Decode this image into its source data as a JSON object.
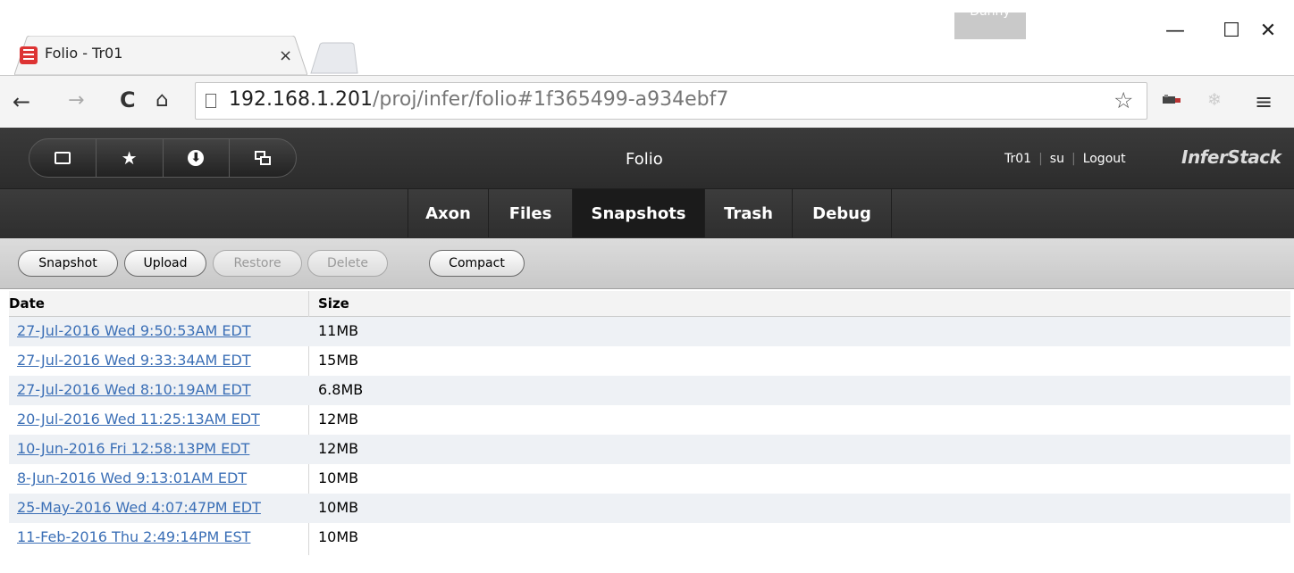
{
  "browser": {
    "profile": "Danny",
    "tab_title": "Folio - Tr01",
    "tab_close": "×",
    "url_host": "192.168.1.201",
    "url_path": "/proj/infer/folio#1f365499-a934ebf7",
    "window_min": "—",
    "window_max": "☐",
    "window_close": "✕",
    "back": "←",
    "forward": "→",
    "reload": "C",
    "home": "⌂",
    "bookmark_star": "☆",
    "menu": "≡"
  },
  "app": {
    "title": "Folio",
    "user": "Tr01",
    "role": "su",
    "logout": "Logout",
    "brand": "InferStack",
    "icons": [
      "window-icon",
      "star-icon",
      "download-icon",
      "windows-icon"
    ],
    "star_glyph": "★",
    "download_glyph": "⬇"
  },
  "nav": {
    "tabs": [
      {
        "label": "Axon",
        "active": false
      },
      {
        "label": "Files",
        "active": false
      },
      {
        "label": "Snapshots",
        "active": true
      },
      {
        "label": "Trash",
        "active": false
      },
      {
        "label": "Debug",
        "active": false
      }
    ]
  },
  "actions": {
    "snapshot": "Snapshot",
    "upload": "Upload",
    "restore": "Restore",
    "delete": "Delete",
    "compact": "Compact"
  },
  "table": {
    "headers": {
      "date": "Date",
      "size": "Size"
    },
    "rows": [
      {
        "date": "27-Jul-2016 Wed 9:50:53AM EDT",
        "size": "11MB"
      },
      {
        "date": "27-Jul-2016 Wed 9:33:34AM EDT",
        "size": "15MB"
      },
      {
        "date": "27-Jul-2016 Wed 8:10:19AM EDT",
        "size": "6.8MB"
      },
      {
        "date": "20-Jul-2016 Wed 11:25:13AM EDT",
        "size": "12MB"
      },
      {
        "date": "10-Jun-2016 Fri 12:58:13PM EDT",
        "size": "12MB"
      },
      {
        "date": "8-Jun-2016 Wed 9:13:01AM EDT",
        "size": "10MB"
      },
      {
        "date": "25-May-2016 Wed 4:07:47PM EDT",
        "size": "10MB"
      },
      {
        "date": "11-Feb-2016 Thu 2:49:14PM EST",
        "size": "10MB"
      }
    ]
  }
}
